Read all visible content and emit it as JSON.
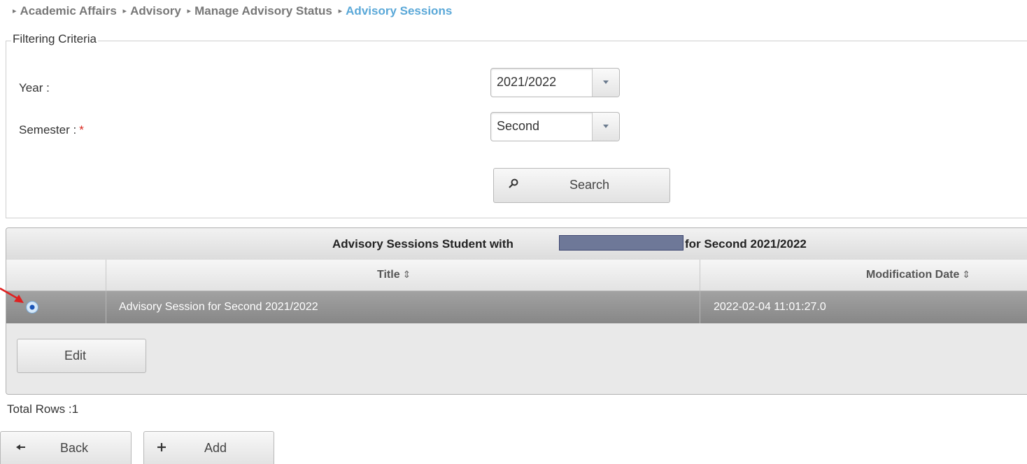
{
  "breadcrumb": {
    "items": [
      "Academic Affairs",
      "Advisory",
      "Manage Advisory Status",
      "Advisory Sessions"
    ],
    "separator": "▸"
  },
  "filter": {
    "legend": "Filtering Criteria",
    "year_label": "Year :",
    "year_value": "2021/2022",
    "semester_label": "Semester :",
    "semester_required": "*",
    "semester_value": "Second",
    "search_label": "Search"
  },
  "grid": {
    "caption_before": "Advisory Sessions Student with",
    "caption_after": "for Second 2021/2022",
    "columns": [
      "Title",
      "Modification Date"
    ],
    "sort_icon": "⇕",
    "rows": [
      {
        "title": "Advisory Session for Second 2021/2022",
        "modified": "2022-02-04 11:01:27.0"
      }
    ],
    "edit_label": "Edit"
  },
  "footer": {
    "total_rows": "Total Rows :1",
    "back_label": "Back",
    "add_label": "Add"
  },
  "colors": {
    "breadcrumb_current": "#5aa8d8",
    "required": "#d9251c",
    "selected_row": "#939393",
    "annotation_arrow": "#e02020"
  }
}
